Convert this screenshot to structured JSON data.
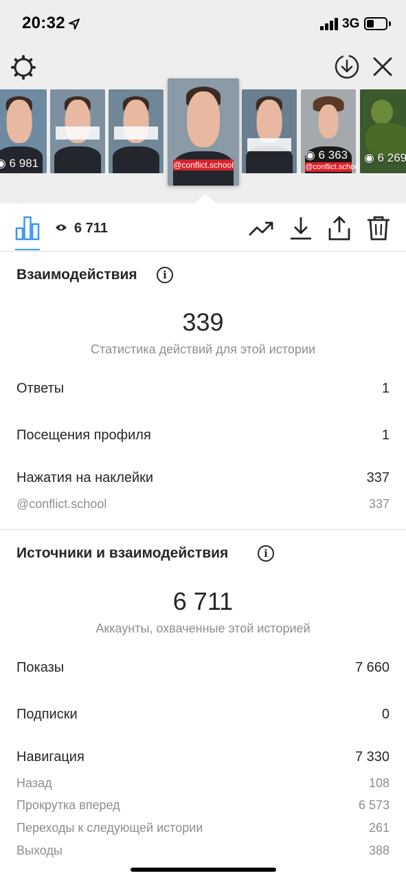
{
  "status_bar": {
    "time": "20:32",
    "network": "3G"
  },
  "thumbnails": [
    {
      "views": "◉ 6 981",
      "bg": "#6d8aa0",
      "tag": ""
    },
    {
      "views": "",
      "bg": "#7d90a0",
      "tag": ""
    },
    {
      "views": "",
      "bg": "#6f8797",
      "tag": ""
    },
    {
      "views": "",
      "bg": "#8a9aa6",
      "tag": "@conflict.school",
      "active": true
    },
    {
      "views": "",
      "bg": "#6a7f8f",
      "tag": ""
    },
    {
      "views": "◉ 6 363",
      "bg": "#a4a9ad",
      "tag": "@conflict.school"
    },
    {
      "views": "◉ 6 269",
      "bg": "#3a5a2d",
      "tag": ""
    }
  ],
  "toolbar": {
    "views": "6 711"
  },
  "interactions": {
    "title": "Взаимодействия",
    "total": "339",
    "caption": "Статистика действий для этой истории",
    "rows": [
      {
        "label": "Ответы",
        "value": "1"
      },
      {
        "label": "Посещения профиля",
        "value": "1"
      },
      {
        "label": "Нажатия на наклейки",
        "value": "337"
      }
    ],
    "sticker_sub": {
      "label": "@conflict.school",
      "value": "337"
    }
  },
  "discovery": {
    "title": "Источники и взаимодействия",
    "total": "6 711",
    "caption": "Аккаунты, охваченные этой историей",
    "rows": [
      {
        "label": "Показы",
        "value": "7 660"
      },
      {
        "label": "Подписки",
        "value": "0"
      },
      {
        "label": "Навигация",
        "value": "7 330"
      }
    ],
    "navigation_sub": [
      {
        "label": "Назад",
        "value": "108"
      },
      {
        "label": "Прокрутка вперед",
        "value": "6 573"
      },
      {
        "label": "Переходы к следующей истории",
        "value": "261"
      },
      {
        "label": "Выходы",
        "value": "388"
      }
    ]
  },
  "colors": {
    "accent": "#3897f0",
    "muted": "#8e8e8e",
    "text": "#262626"
  }
}
